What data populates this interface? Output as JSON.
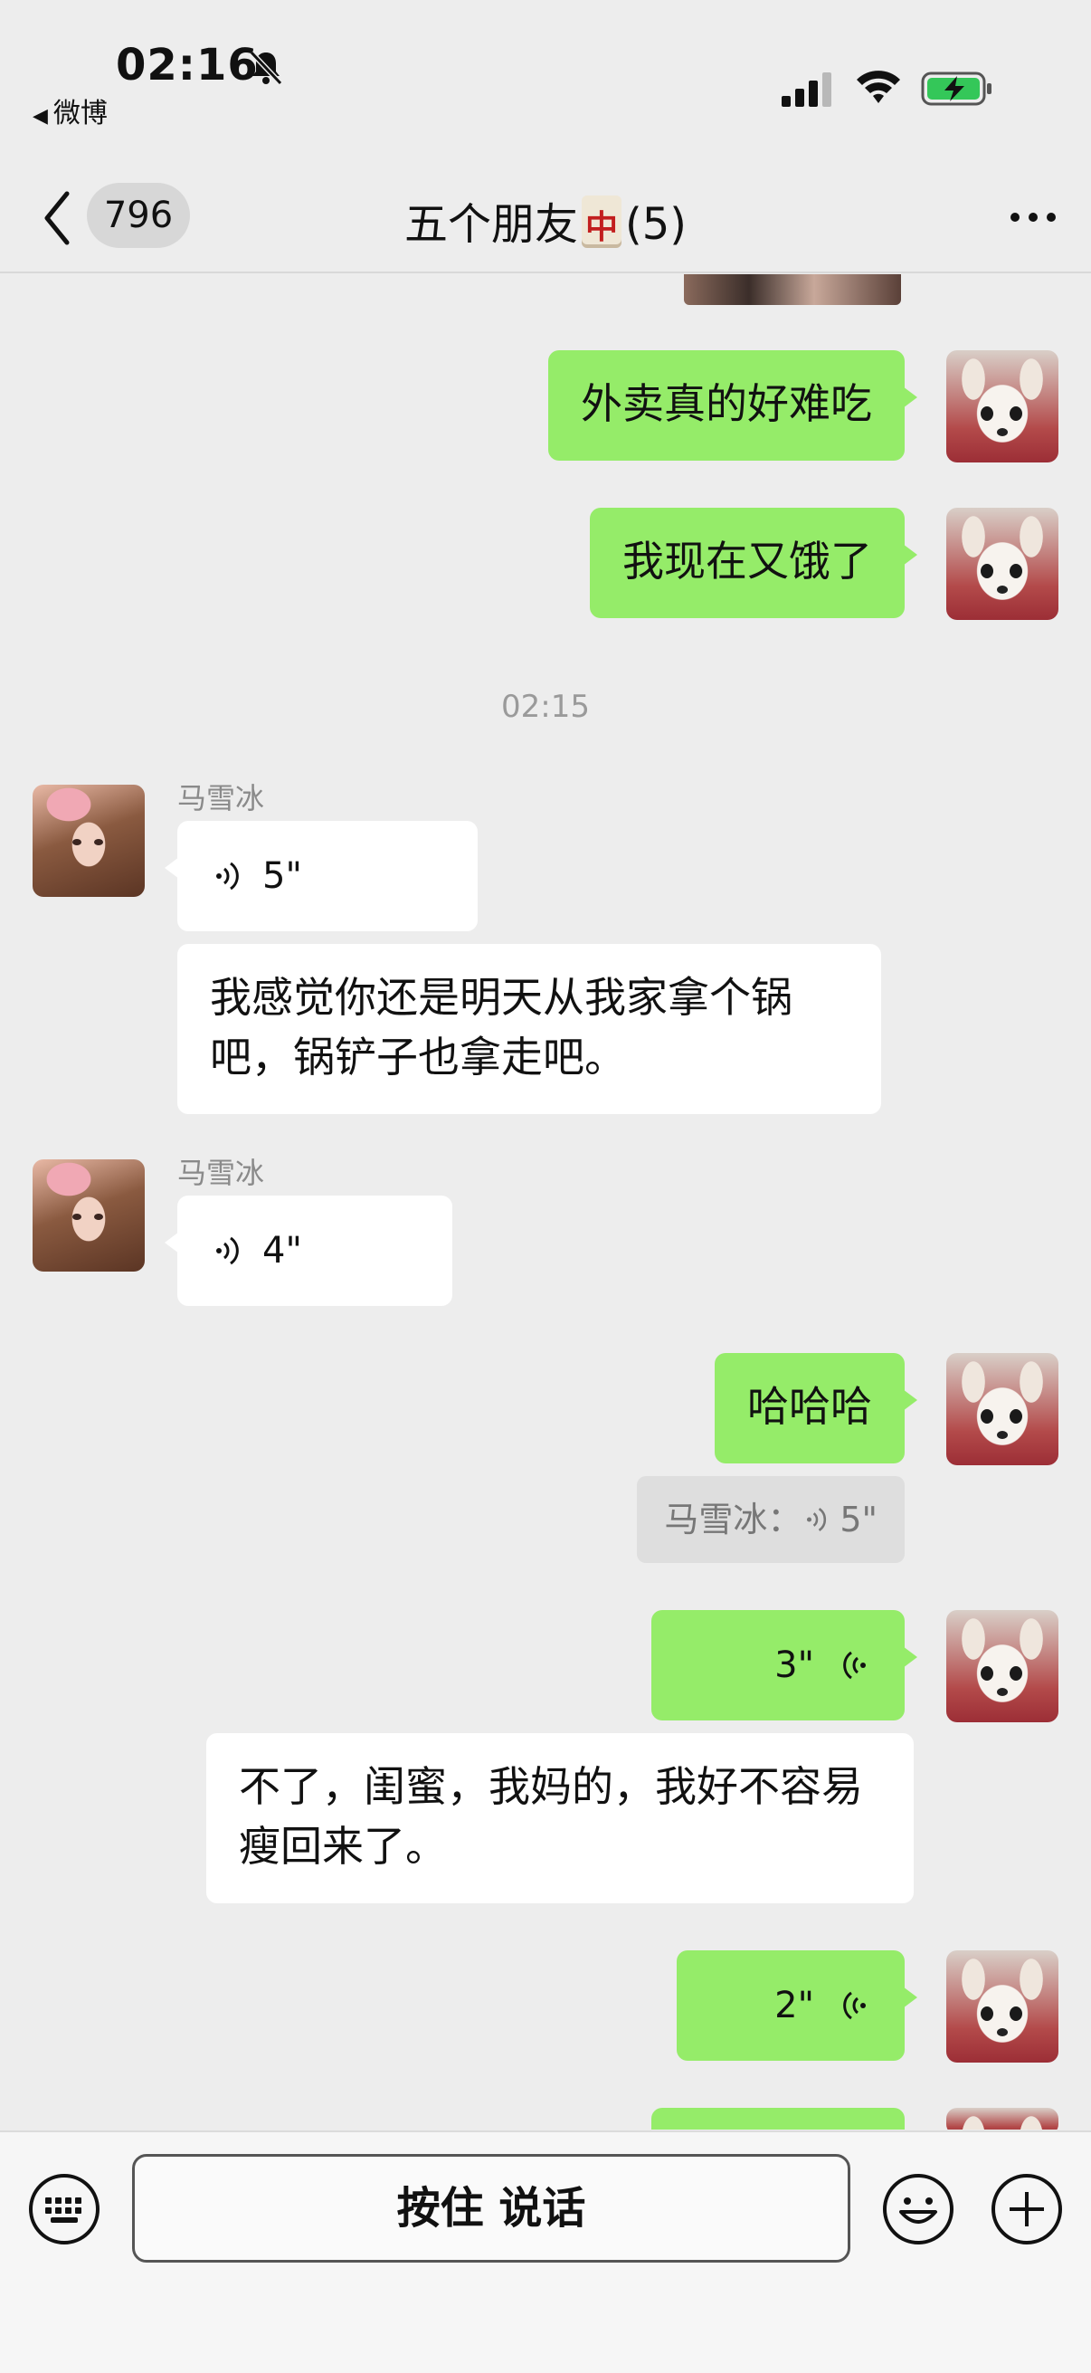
{
  "status": {
    "time": "02:16",
    "back_app": "微博"
  },
  "nav": {
    "unread_count": "796",
    "title_prefix": "五个朋友",
    "mahjong_char": "中",
    "title_suffix": "(5)"
  },
  "messages": {
    "m1": "外卖真的好难吃",
    "m2": "我现在又饿了",
    "timestamp": "02:15",
    "sender1": "马雪冰",
    "voice1": "5\"",
    "m3": "我感觉你还是明天从我家拿个锅吧，锅铲子也拿走吧。",
    "sender2": "马雪冰",
    "voice2": "4\"",
    "m4": "哈哈哈",
    "quote": "马雪冰：",
    "quote_voice": "5\"",
    "voice3": "3\"",
    "m5": "不了，闺蜜，我妈的，我好不容易瘦回来了。",
    "voice4": "2\""
  },
  "input": {
    "hold_to_talk": "按住 说话"
  },
  "colors": {
    "bubble_green": "#95ec69",
    "background": "#ededed",
    "bubble_white": "#ffffff"
  }
}
